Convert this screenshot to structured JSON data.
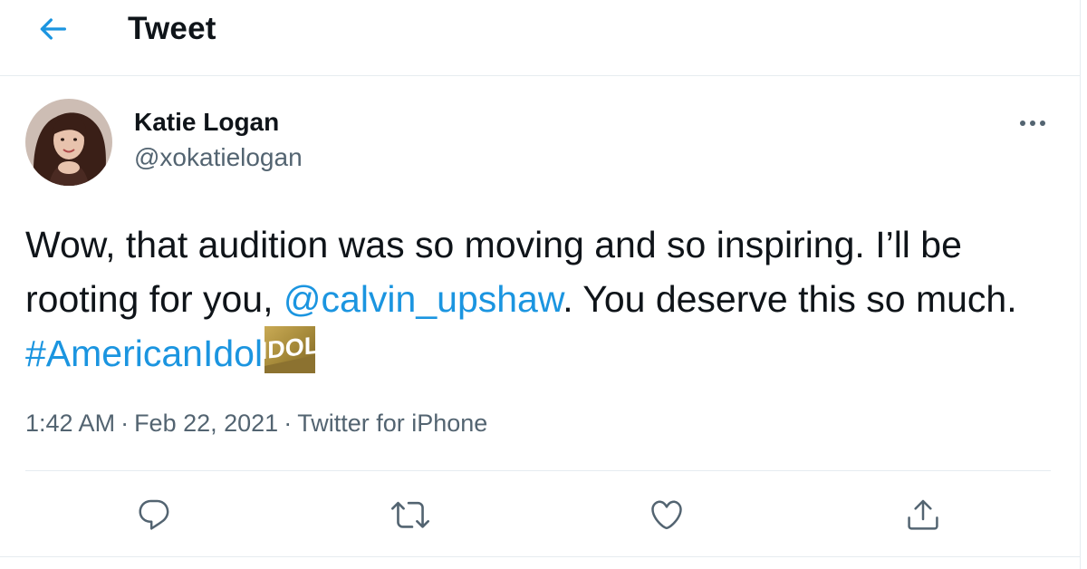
{
  "header": {
    "title": "Tweet",
    "back_icon": "arrow-left-icon"
  },
  "tweet": {
    "author": {
      "name": "Katie Logan",
      "handle": "@xokatielogan"
    },
    "text": {
      "part1": "Wow, that audition was so moving and so inspiring. I’ll be rooting for you, ",
      "mention": "@calvin_upshaw",
      "part2": ". You deserve this so much. ",
      "hashtag": "#AmericanIdol",
      "hashflag_text": "IDOL"
    },
    "meta": {
      "time": "1:42 AM",
      "separator": "·",
      "date": "Feb 22, 2021",
      "source": "Twitter for iPhone"
    },
    "actions": [
      {
        "icon": "reply-icon"
      },
      {
        "icon": "retweet-icon"
      },
      {
        "icon": "like-icon"
      },
      {
        "icon": "share-icon"
      }
    ]
  },
  "colors": {
    "accent": "#1b95e0",
    "text_primary": "#0f1419",
    "text_secondary": "#536471",
    "divider": "#e6ecf0",
    "hashflag_gold": "#a68a3a"
  }
}
